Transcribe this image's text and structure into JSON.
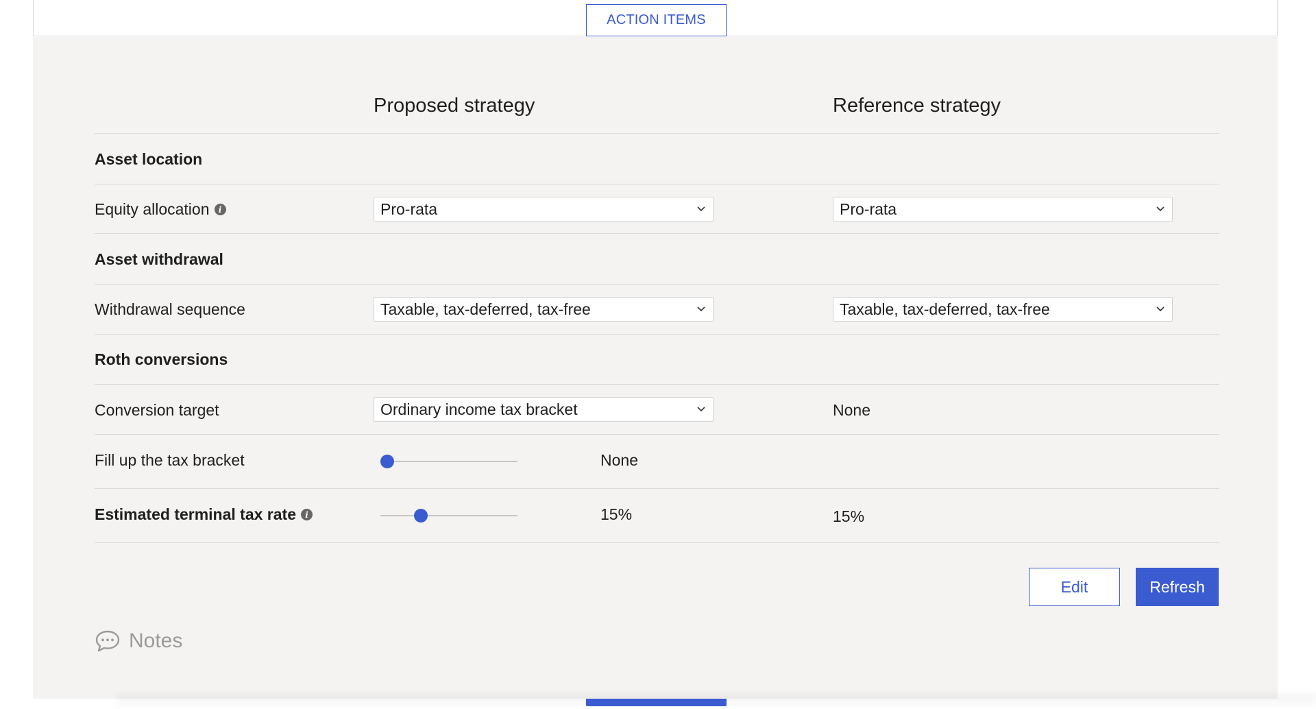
{
  "header": {
    "tab_label": "ACTION ITEMS"
  },
  "columns": {
    "proposed": "Proposed strategy",
    "reference": "Reference strategy"
  },
  "sections": {
    "asset_location": "Asset location",
    "asset_withdrawal": "Asset withdrawal",
    "roth_conversions": "Roth conversions"
  },
  "rows": {
    "equity_allocation": {
      "label": "Equity allocation",
      "proposed": "Pro-rata",
      "reference": "Pro-rata"
    },
    "withdrawal_sequence": {
      "label": "Withdrawal sequence",
      "proposed": "Taxable, tax-deferred, tax-free",
      "reference": "Taxable, tax-deferred, tax-free"
    },
    "conversion_target": {
      "label": "Conversion target",
      "proposed": "Ordinary income tax bracket",
      "reference": "None"
    },
    "fill_bracket": {
      "label": "Fill up the tax bracket",
      "proposed_value": "None",
      "slider_fraction": 0.0
    },
    "terminal_tax": {
      "label": "Estimated terminal tax rate",
      "proposed_value": "15%",
      "reference": "15%",
      "slider_fraction": 0.27
    }
  },
  "buttons": {
    "edit": "Edit",
    "refresh": "Refresh"
  },
  "notes": {
    "label": "Notes"
  },
  "colors": {
    "accent": "#3b5bd1",
    "panel": "#f4f3f1",
    "divider": "#dcdad6"
  },
  "icons": [
    "info-icon",
    "chevron-down-icon",
    "comment-icon"
  ]
}
